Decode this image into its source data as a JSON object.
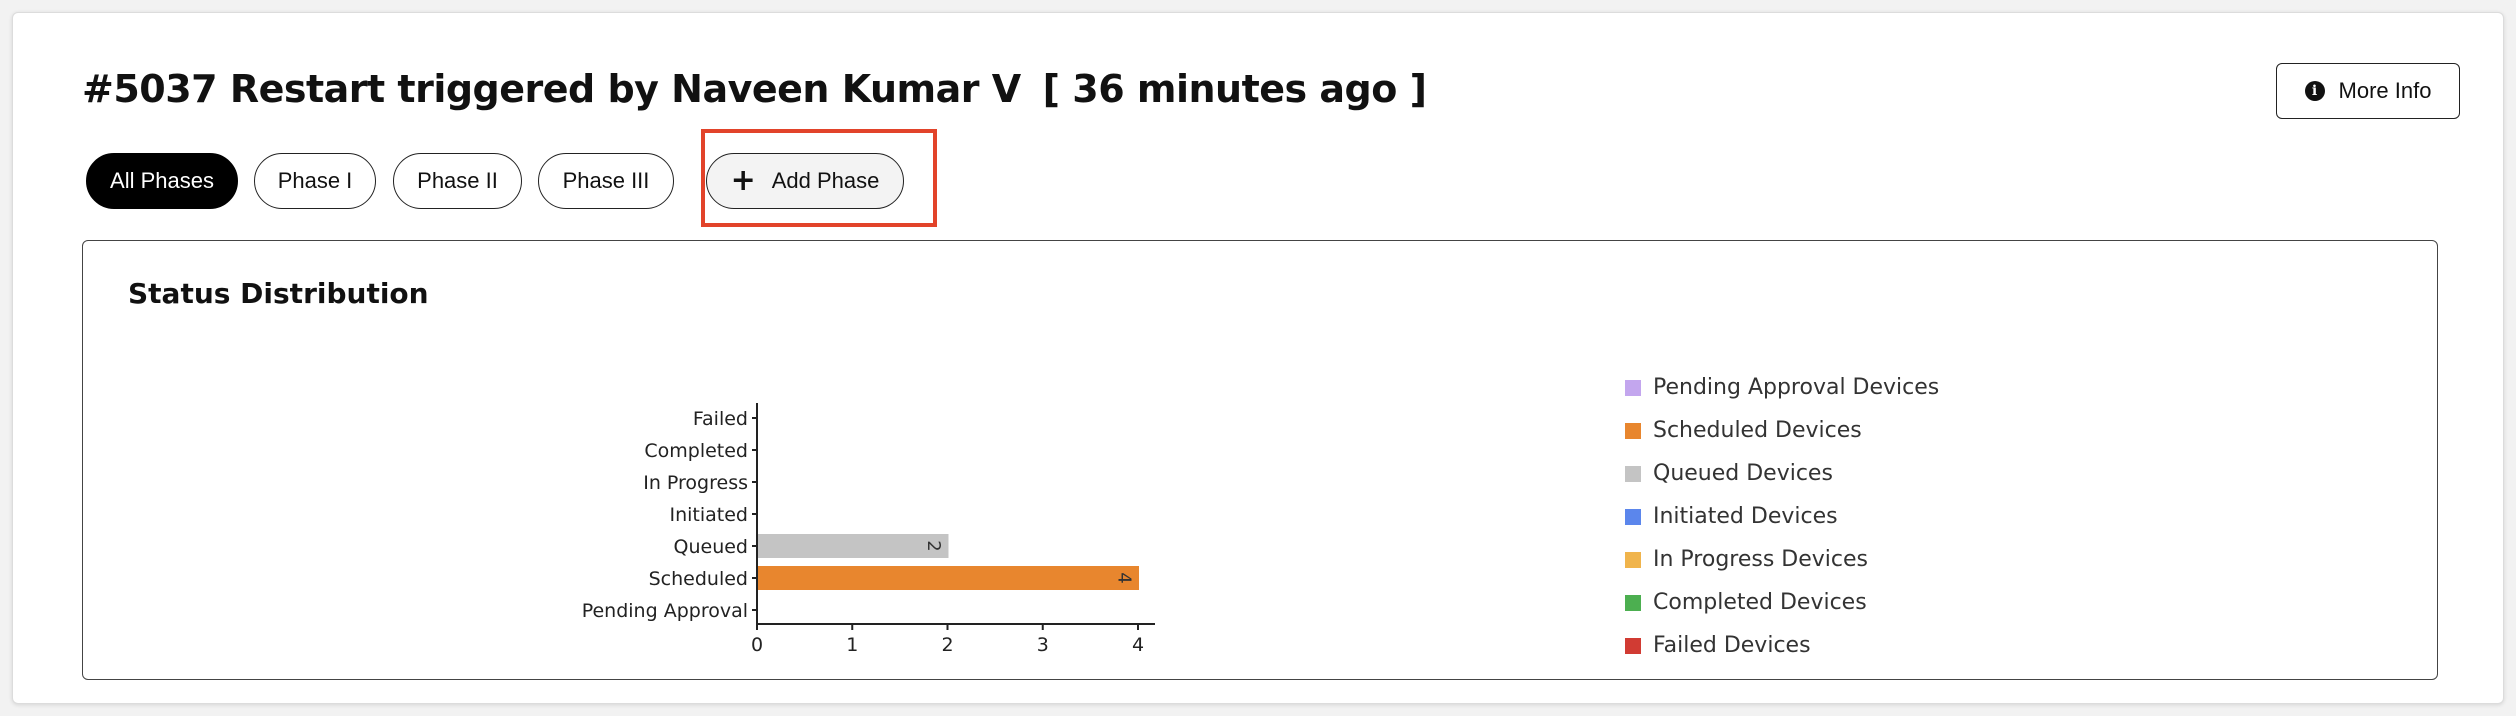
{
  "header": {
    "title": "#5037 Restart triggered by Naveen Kumar V",
    "time_ago": "[ 36 minutes ago ]",
    "more_info_label": "More Info"
  },
  "phases": {
    "items": [
      {
        "label": "All Phases",
        "active": true
      },
      {
        "label": "Phase I",
        "active": false
      },
      {
        "label": "Phase II",
        "active": false
      },
      {
        "label": "Phase III",
        "active": false
      }
    ],
    "add_label": "Add Phase"
  },
  "panel": {
    "title": "Status Distribution"
  },
  "chart_data": {
    "type": "bar",
    "orientation": "horizontal",
    "categories": [
      "Pending Approval",
      "Scheduled",
      "Queued",
      "Initiated",
      "In Progress",
      "Completed",
      "Failed"
    ],
    "values": [
      0,
      4,
      2,
      0,
      0,
      0,
      0
    ],
    "colors": [
      "#c3a6ee",
      "#e8862e",
      "#c4c4c4",
      "#5b86ec",
      "#f0b44c",
      "#4caf50",
      "#d13b33"
    ],
    "xticks": [
      "0",
      "1",
      "2",
      "3",
      "4"
    ],
    "xlim": [
      0,
      4.2
    ],
    "data_labels": true,
    "grid": false,
    "legend": {
      "placement": "right",
      "entries": [
        {
          "name": "Pending Approval Devices",
          "color": "#c3a6ee"
        },
        {
          "name": "Scheduled Devices",
          "color": "#e8862e"
        },
        {
          "name": "Queued Devices",
          "color": "#c4c4c4"
        },
        {
          "name": "Initiated Devices",
          "color": "#5b86ec"
        },
        {
          "name": "In Progress Devices",
          "color": "#f0b44c"
        },
        {
          "name": "Completed Devices",
          "color": "#4caf50"
        },
        {
          "name": "Failed Devices",
          "color": "#d13b33"
        }
      ]
    }
  }
}
